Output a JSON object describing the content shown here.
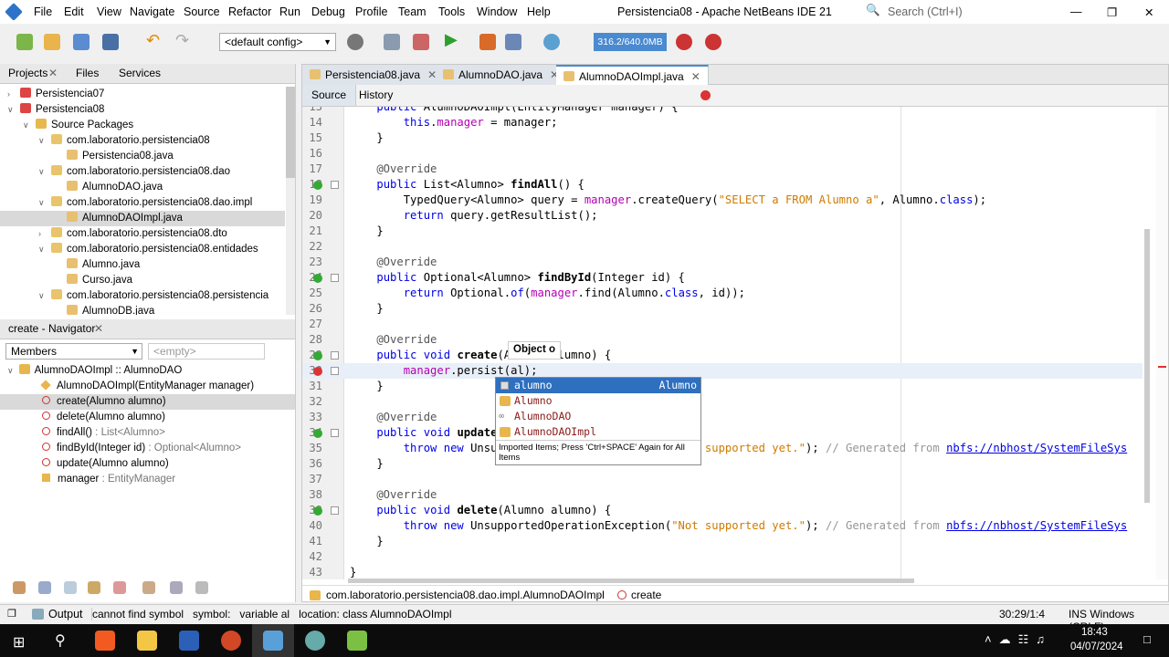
{
  "titlebar": {
    "menus": [
      "File",
      "Edit",
      "View",
      "Navigate",
      "Source",
      "Refactor",
      "Run",
      "Debug",
      "Profile",
      "Team",
      "Tools",
      "Window",
      "Help"
    ],
    "title": "Persistencia08 - Apache NetBeans IDE 21",
    "search_placeholder": "Search (Ctrl+I)"
  },
  "toolbar": {
    "config": "<default config>",
    "memory": "316.2/640.0MB"
  },
  "projects": {
    "tabs": [
      "Projects",
      "Files",
      "Services"
    ],
    "items": [
      {
        "label": "Persistencia07",
        "depth": 0,
        "type": "project",
        "exp": "+"
      },
      {
        "label": "Persistencia08",
        "depth": 0,
        "type": "project",
        "exp": "-"
      },
      {
        "label": "Source Packages",
        "depth": 1,
        "type": "folder",
        "exp": "-"
      },
      {
        "label": "com.laboratorio.persistencia08",
        "depth": 2,
        "type": "package",
        "exp": "-"
      },
      {
        "label": "Persistencia08.java",
        "depth": 3,
        "type": "java"
      },
      {
        "label": "com.laboratorio.persistencia08.dao",
        "depth": 2,
        "type": "package",
        "exp": "-"
      },
      {
        "label": "AlumnoDAO.java",
        "depth": 3,
        "type": "java"
      },
      {
        "label": "com.laboratorio.persistencia08.dao.impl",
        "depth": 2,
        "type": "package",
        "exp": "-"
      },
      {
        "label": "AlumnoDAOImpl.java",
        "depth": 3,
        "type": "java",
        "selected": true
      },
      {
        "label": "com.laboratorio.persistencia08.dto",
        "depth": 2,
        "type": "package",
        "exp": "+"
      },
      {
        "label": "com.laboratorio.persistencia08.entidades",
        "depth": 2,
        "type": "package",
        "exp": "-"
      },
      {
        "label": "Alumno.java",
        "depth": 3,
        "type": "java"
      },
      {
        "label": "Curso.java",
        "depth": 3,
        "type": "java"
      },
      {
        "label": "com.laboratorio.persistencia08.persistencia",
        "depth": 2,
        "type": "package",
        "exp": "-"
      },
      {
        "label": "AlumnoDB.java",
        "depth": 3,
        "type": "java"
      }
    ]
  },
  "navigator": {
    "title": "create - Navigator",
    "filter": "Members",
    "filter2": "<empty>",
    "root": "AlumnoDAOImpl :: AlumnoDAO",
    "items": [
      {
        "name": "AlumnoDAOImpl(EntityManager manager)",
        "type": "",
        "kind": "ctor"
      },
      {
        "name": "create(Alumno alumno)",
        "type": "",
        "kind": "method",
        "selected": true
      },
      {
        "name": "delete(Alumno alumno)",
        "type": "",
        "kind": "method"
      },
      {
        "name": "findAll()",
        "type": " : List<Alumno>",
        "kind": "method"
      },
      {
        "name": "findById(Integer id)",
        "type": " : Optional<Alumno>",
        "kind": "method"
      },
      {
        "name": "update(Alumno alumno)",
        "type": "",
        "kind": "method"
      },
      {
        "name": "manager",
        "type": " : EntityManager",
        "kind": "field"
      }
    ]
  },
  "editor": {
    "tabs": [
      "Persistencia08.java",
      "AlumnoDAO.java",
      "AlumnoDAOImpl.java"
    ],
    "active_tab": 2,
    "source_label": "Source",
    "history_label": "History",
    "lines": [
      {
        "n": "13",
        "c": [
          [
            "    ",
            ""
          ],
          [
            "public",
            "kw"
          ],
          [
            " AlumnoDAOImpl(EntityManager manager) {",
            ""
          ]
        ]
      },
      {
        "n": "14",
        "c": [
          [
            "        ",
            ""
          ],
          [
            "this",
            "kw"
          ],
          [
            ".",
            ""
          ],
          [
            "manager",
            "fld"
          ],
          [
            " = manager;",
            ""
          ]
        ]
      },
      {
        "n": "15",
        "c": [
          [
            "    }",
            ""
          ]
        ]
      },
      {
        "n": "16",
        "c": []
      },
      {
        "n": "17",
        "c": [
          [
            "    @Override",
            "ann"
          ]
        ]
      },
      {
        "n": "18",
        "c": [
          [
            "    ",
            ""
          ],
          [
            "public",
            "kw"
          ],
          [
            " List<Alumno> ",
            ""
          ],
          [
            "findAll",
            "bold"
          ],
          [
            "() {",
            ""
          ]
        ],
        "mark": "impl"
      },
      {
        "n": "19",
        "c": [
          [
            "        TypedQuery<Alumno> query = ",
            ""
          ],
          [
            "manager",
            "fld"
          ],
          [
            ".createQuery(",
            ""
          ],
          [
            "\"SELECT a FROM Alumno a\"",
            "str"
          ],
          [
            ", Alumno.",
            ""
          ],
          [
            "class",
            "kw"
          ],
          [
            ");",
            ""
          ]
        ]
      },
      {
        "n": "20",
        "c": [
          [
            "        ",
            ""
          ],
          [
            "return",
            "kw"
          ],
          [
            " query.getResultList();",
            ""
          ]
        ]
      },
      {
        "n": "21",
        "c": [
          [
            "    }",
            ""
          ]
        ]
      },
      {
        "n": "22",
        "c": []
      },
      {
        "n": "23",
        "c": [
          [
            "    @Override",
            "ann"
          ]
        ]
      },
      {
        "n": "24",
        "c": [
          [
            "    ",
            ""
          ],
          [
            "public",
            "kw"
          ],
          [
            " Optional<Alumno> ",
            ""
          ],
          [
            "findById",
            "bold"
          ],
          [
            "(Integer id) {",
            ""
          ]
        ],
        "mark": "impl"
      },
      {
        "n": "25",
        "c": [
          [
            "        ",
            ""
          ],
          [
            "return",
            "kw"
          ],
          [
            " Optional.",
            ""
          ],
          [
            "of",
            "kw"
          ],
          [
            "(",
            ""
          ],
          [
            "manager",
            "fld"
          ],
          [
            ".find(Alumno.",
            ""
          ],
          [
            "class",
            "kw"
          ],
          [
            ", id));",
            ""
          ]
        ]
      },
      {
        "n": "26",
        "c": [
          [
            "    }",
            ""
          ]
        ]
      },
      {
        "n": "27",
        "c": []
      },
      {
        "n": "28",
        "c": [
          [
            "    @Override",
            "ann"
          ]
        ]
      },
      {
        "n": "29",
        "c": [
          [
            "    ",
            ""
          ],
          [
            "public",
            "kw"
          ],
          [
            " ",
            ""
          ],
          [
            "void",
            "kw"
          ],
          [
            " ",
            ""
          ],
          [
            "create",
            "bold"
          ],
          [
            "(Alumno alumno) {",
            ""
          ]
        ],
        "mark": "impl"
      },
      {
        "n": "30",
        "c": [
          [
            "        ",
            ""
          ],
          [
            "manager",
            "fld"
          ],
          [
            ".persist(al);",
            ""
          ]
        ],
        "mark": "error",
        "current": true
      },
      {
        "n": "31",
        "c": [
          [
            "    }",
            ""
          ]
        ]
      },
      {
        "n": "32",
        "c": []
      },
      {
        "n": "33",
        "c": [
          [
            "    @Override",
            "ann"
          ]
        ]
      },
      {
        "n": "34",
        "c": [
          [
            "    ",
            ""
          ],
          [
            "public",
            "kw"
          ],
          [
            " ",
            ""
          ],
          [
            "void",
            "kw"
          ],
          [
            " ",
            ""
          ],
          [
            "update",
            "bold"
          ],
          [
            "(Alumno alumno) {",
            ""
          ]
        ],
        "mark": "impl"
      },
      {
        "n": "35",
        "c": [
          [
            "        ",
            ""
          ],
          [
            "throw",
            "kw"
          ],
          [
            " ",
            ""
          ],
          [
            "new",
            "kw"
          ],
          [
            " UnsupportedOperationException(",
            ""
          ],
          [
            "\"Not supported yet.\"",
            "str"
          ],
          [
            "); ",
            ""
          ],
          [
            "// Generated from ",
            "cm"
          ],
          [
            "nbfs://nbhost/SystemFileSys",
            "lnk"
          ]
        ]
      },
      {
        "n": "36",
        "c": [
          [
            "    }",
            ""
          ]
        ]
      },
      {
        "n": "37",
        "c": []
      },
      {
        "n": "38",
        "c": [
          [
            "    @Override",
            "ann"
          ]
        ]
      },
      {
        "n": "39",
        "c": [
          [
            "    ",
            ""
          ],
          [
            "public",
            "kw"
          ],
          [
            " ",
            ""
          ],
          [
            "void",
            "kw"
          ],
          [
            " ",
            ""
          ],
          [
            "delete",
            "bold"
          ],
          [
            "(Alumno alumno) {",
            ""
          ]
        ],
        "mark": "impl"
      },
      {
        "n": "40",
        "c": [
          [
            "        ",
            ""
          ],
          [
            "throw",
            "kw"
          ],
          [
            " ",
            ""
          ],
          [
            "new",
            "kw"
          ],
          [
            " UnsupportedOperationException(",
            ""
          ],
          [
            "\"Not supported yet.\"",
            "str"
          ],
          [
            "); ",
            ""
          ],
          [
            "// Generated from ",
            "cm"
          ],
          [
            "nbfs://nbhost/SystemFileSys",
            "lnk"
          ]
        ]
      },
      {
        "n": "41",
        "c": [
          [
            "    }",
            ""
          ]
        ]
      },
      {
        "n": "42",
        "c": []
      },
      {
        "n": "43",
        "c": [
          [
            "}",
            ""
          ]
        ]
      }
    ],
    "tooltip": "Object o",
    "completion": {
      "items": [
        {
          "label": "alumno",
          "type": "Alumno",
          "kind": "var"
        },
        {
          "label": "Alumno",
          "type": "",
          "kind": "class"
        },
        {
          "label": "AlumnoDAO",
          "type": "",
          "kind": "iface"
        },
        {
          "label": "AlumnoDAOImpl",
          "type": "",
          "kind": "class"
        }
      ],
      "hint": "Imported Items; Press 'Ctrl+SPACE' Again for All Items"
    },
    "breadcrumb": [
      "com.laboratorio.persistencia08.dao.impl.AlumnoDAOImpl",
      "create"
    ]
  },
  "status": {
    "output_label": "Output",
    "message": "cannot find symbol   symbol:   variable al   location: class AlumnoDAOImpl",
    "position": "30:29/1:4",
    "mode": "INS Windows (CRLF)"
  },
  "taskbar": {
    "time": "18:43",
    "date": "04/07/2024"
  }
}
